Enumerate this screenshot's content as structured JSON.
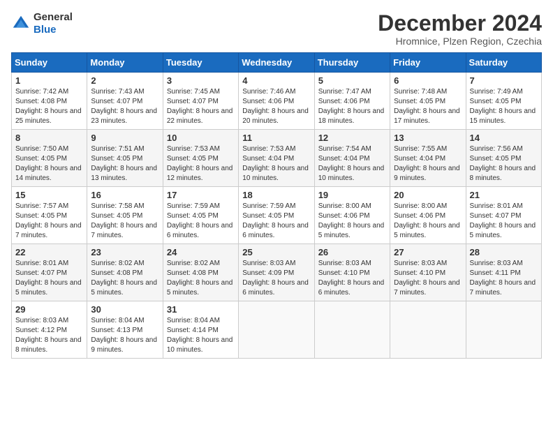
{
  "header": {
    "logo_general": "General",
    "logo_blue": "Blue",
    "month_title": "December 2024",
    "location": "Hromnice, Plzen Region, Czechia"
  },
  "weekdays": [
    "Sunday",
    "Monday",
    "Tuesday",
    "Wednesday",
    "Thursday",
    "Friday",
    "Saturday"
  ],
  "weeks": [
    [
      {
        "day": "1",
        "sunrise": "7:42 AM",
        "sunset": "4:08 PM",
        "daylight": "8 hours and 25 minutes."
      },
      {
        "day": "2",
        "sunrise": "7:43 AM",
        "sunset": "4:07 PM",
        "daylight": "8 hours and 23 minutes."
      },
      {
        "day": "3",
        "sunrise": "7:45 AM",
        "sunset": "4:07 PM",
        "daylight": "8 hours and 22 minutes."
      },
      {
        "day": "4",
        "sunrise": "7:46 AM",
        "sunset": "4:06 PM",
        "daylight": "8 hours and 20 minutes."
      },
      {
        "day": "5",
        "sunrise": "7:47 AM",
        "sunset": "4:06 PM",
        "daylight": "8 hours and 18 minutes."
      },
      {
        "day": "6",
        "sunrise": "7:48 AM",
        "sunset": "4:05 PM",
        "daylight": "8 hours and 17 minutes."
      },
      {
        "day": "7",
        "sunrise": "7:49 AM",
        "sunset": "4:05 PM",
        "daylight": "8 hours and 15 minutes."
      }
    ],
    [
      {
        "day": "8",
        "sunrise": "7:50 AM",
        "sunset": "4:05 PM",
        "daylight": "8 hours and 14 minutes."
      },
      {
        "day": "9",
        "sunrise": "7:51 AM",
        "sunset": "4:05 PM",
        "daylight": "8 hours and 13 minutes."
      },
      {
        "day": "10",
        "sunrise": "7:53 AM",
        "sunset": "4:05 PM",
        "daylight": "8 hours and 12 minutes."
      },
      {
        "day": "11",
        "sunrise": "7:53 AM",
        "sunset": "4:04 PM",
        "daylight": "8 hours and 10 minutes."
      },
      {
        "day": "12",
        "sunrise": "7:54 AM",
        "sunset": "4:04 PM",
        "daylight": "8 hours and 10 minutes."
      },
      {
        "day": "13",
        "sunrise": "7:55 AM",
        "sunset": "4:04 PM",
        "daylight": "8 hours and 9 minutes."
      },
      {
        "day": "14",
        "sunrise": "7:56 AM",
        "sunset": "4:05 PM",
        "daylight": "8 hours and 8 minutes."
      }
    ],
    [
      {
        "day": "15",
        "sunrise": "7:57 AM",
        "sunset": "4:05 PM",
        "daylight": "8 hours and 7 minutes."
      },
      {
        "day": "16",
        "sunrise": "7:58 AM",
        "sunset": "4:05 PM",
        "daylight": "8 hours and 7 minutes."
      },
      {
        "day": "17",
        "sunrise": "7:59 AM",
        "sunset": "4:05 PM",
        "daylight": "8 hours and 6 minutes."
      },
      {
        "day": "18",
        "sunrise": "7:59 AM",
        "sunset": "4:05 PM",
        "daylight": "8 hours and 6 minutes."
      },
      {
        "day": "19",
        "sunrise": "8:00 AM",
        "sunset": "4:06 PM",
        "daylight": "8 hours and 5 minutes."
      },
      {
        "day": "20",
        "sunrise": "8:00 AM",
        "sunset": "4:06 PM",
        "daylight": "8 hours and 5 minutes."
      },
      {
        "day": "21",
        "sunrise": "8:01 AM",
        "sunset": "4:07 PM",
        "daylight": "8 hours and 5 minutes."
      }
    ],
    [
      {
        "day": "22",
        "sunrise": "8:01 AM",
        "sunset": "4:07 PM",
        "daylight": "8 hours and 5 minutes."
      },
      {
        "day": "23",
        "sunrise": "8:02 AM",
        "sunset": "4:08 PM",
        "daylight": "8 hours and 5 minutes."
      },
      {
        "day": "24",
        "sunrise": "8:02 AM",
        "sunset": "4:08 PM",
        "daylight": "8 hours and 5 minutes."
      },
      {
        "day": "25",
        "sunrise": "8:03 AM",
        "sunset": "4:09 PM",
        "daylight": "8 hours and 6 minutes."
      },
      {
        "day": "26",
        "sunrise": "8:03 AM",
        "sunset": "4:10 PM",
        "daylight": "8 hours and 6 minutes."
      },
      {
        "day": "27",
        "sunrise": "8:03 AM",
        "sunset": "4:10 PM",
        "daylight": "8 hours and 7 minutes."
      },
      {
        "day": "28",
        "sunrise": "8:03 AM",
        "sunset": "4:11 PM",
        "daylight": "8 hours and 7 minutes."
      }
    ],
    [
      {
        "day": "29",
        "sunrise": "8:03 AM",
        "sunset": "4:12 PM",
        "daylight": "8 hours and 8 minutes."
      },
      {
        "day": "30",
        "sunrise": "8:04 AM",
        "sunset": "4:13 PM",
        "daylight": "8 hours and 9 minutes."
      },
      {
        "day": "31",
        "sunrise": "8:04 AM",
        "sunset": "4:14 PM",
        "daylight": "8 hours and 10 minutes."
      },
      null,
      null,
      null,
      null
    ]
  ]
}
